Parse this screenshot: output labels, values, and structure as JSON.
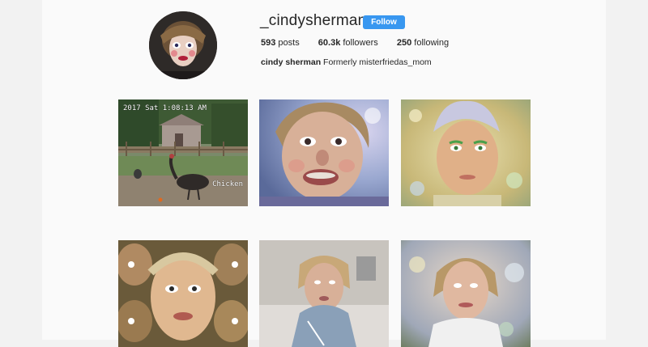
{
  "profile": {
    "username": "_cindysherman_",
    "follow_label": "Follow",
    "stats": {
      "posts_count": "593",
      "posts_label": "posts",
      "followers_count": "60.3k",
      "followers_label": "followers",
      "following_count": "250",
      "following_label": "following"
    },
    "full_name": "cindy sherman",
    "bio_text": "Formerly misterfriedas_mom"
  },
  "posts": [
    {
      "stamp": "2017 Sat 1:08:13 AM",
      "label": "Chicken"
    },
    {},
    {},
    {},
    {},
    {}
  ],
  "colors": {
    "follow_button": "#3897f0",
    "text": "#262626",
    "page_bg": "#fafafa"
  },
  "icons": [
    "avatar-image"
  ]
}
